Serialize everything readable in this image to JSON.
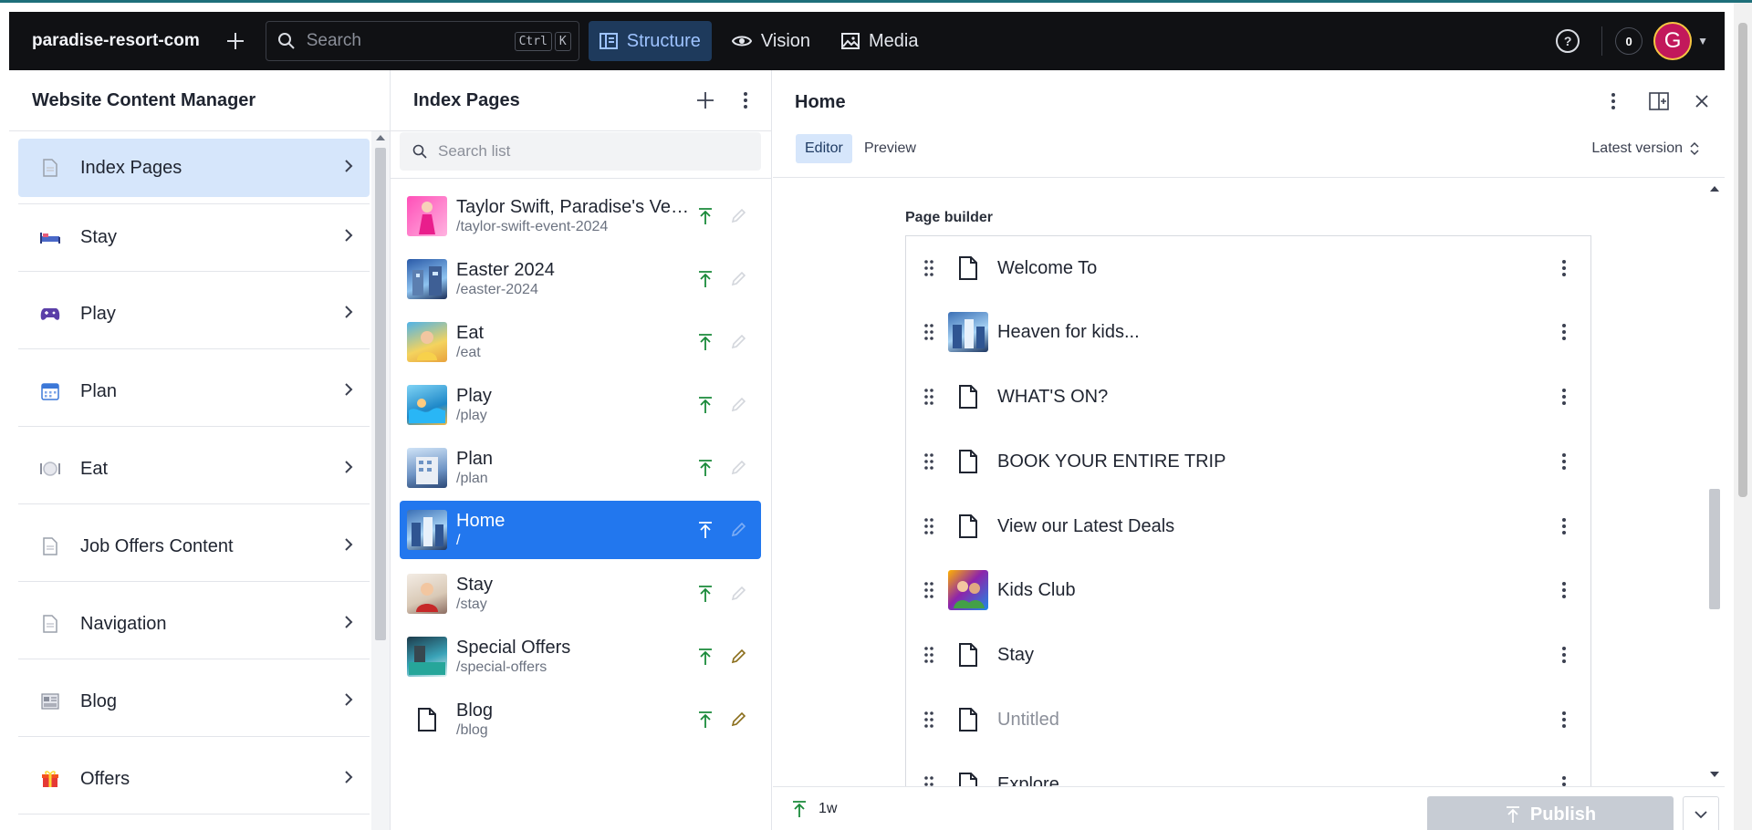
{
  "app": {
    "project_name": "paradise-resort-com",
    "search_placeholder": "Search",
    "search_shortcut": [
      "Ctrl",
      "K"
    ],
    "nav_tabs": [
      {
        "label": "Structure",
        "icon": "structure-icon",
        "active": true
      },
      {
        "label": "Vision",
        "icon": "eye-icon",
        "active": false
      },
      {
        "label": "Media",
        "icon": "image-icon",
        "active": false
      }
    ],
    "notification_count": "0",
    "user_initial": "G"
  },
  "content_manager": {
    "title": "Website Content Manager",
    "items": [
      {
        "label": "Index Pages",
        "icon": "document-icon",
        "active": true
      },
      {
        "label": "Stay",
        "icon": "bed-icon",
        "active": false
      },
      {
        "label": "Play",
        "icon": "gamepad-icon",
        "active": false
      },
      {
        "label": "Plan",
        "icon": "calendar-icon",
        "active": false
      },
      {
        "label": "Eat",
        "icon": "plate-icon",
        "active": false
      },
      {
        "label": "Job Offers Content",
        "icon": "document-icon",
        "active": false
      },
      {
        "label": "Navigation",
        "icon": "document-icon",
        "active": false
      },
      {
        "label": "Blog",
        "icon": "newspaper-icon",
        "active": false
      },
      {
        "label": "Offers",
        "icon": "gift-icon",
        "active": false
      }
    ]
  },
  "index_pages": {
    "title": "Index Pages",
    "search_placeholder": "Search list",
    "documents": [
      {
        "title": "Taylor Swift, Paradise's Vers...",
        "slug": "/taylor-swift-event-2024",
        "thumb": "pink",
        "editable": false,
        "active": false
      },
      {
        "title": "Easter 2024",
        "slug": "/easter-2024",
        "thumb": "blue",
        "editable": false,
        "active": false
      },
      {
        "title": "Eat",
        "slug": "/eat",
        "thumb": "yellow",
        "editable": false,
        "active": false
      },
      {
        "title": "Play",
        "slug": "/play",
        "thumb": "pool",
        "editable": false,
        "active": false
      },
      {
        "title": "Plan",
        "slug": "/plan",
        "thumb": "building",
        "editable": false,
        "active": false
      },
      {
        "title": "Home",
        "slug": "/",
        "thumb": "home",
        "editable": false,
        "active": true
      },
      {
        "title": "Stay",
        "slug": "/stay",
        "thumb": "room",
        "editable": false,
        "active": false
      },
      {
        "title": "Special Offers",
        "slug": "/special-offers",
        "thumb": "teal",
        "editable": true,
        "active": false
      },
      {
        "title": "Blog",
        "slug": "/blog",
        "thumb": "doc",
        "editable": true,
        "active": false
      }
    ]
  },
  "editor": {
    "title": "Home",
    "tabs": [
      {
        "label": "Editor",
        "active": true
      },
      {
        "label": "Preview",
        "active": false
      }
    ],
    "version_label": "Latest version",
    "page_builder_label": "Page builder",
    "blocks": [
      {
        "label": "Welcome To",
        "thumb": "doc",
        "muted": false
      },
      {
        "label": "Heaven for kids...",
        "thumb": "building",
        "muted": false
      },
      {
        "label": "WHAT'S ON?",
        "thumb": "doc",
        "muted": false
      },
      {
        "label": "BOOK YOUR ENTIRE TRIP",
        "thumb": "doc",
        "muted": false
      },
      {
        "label": "View our Latest Deals",
        "thumb": "doc",
        "muted": false
      },
      {
        "label": "Kids Club",
        "thumb": "kids",
        "muted": false
      },
      {
        "label": "Stay",
        "thumb": "doc",
        "muted": false
      },
      {
        "label": "Untitled",
        "thumb": "doc",
        "muted": true
      },
      {
        "label": "Explore",
        "thumb": "doc",
        "muted": false
      }
    ],
    "footer_status": "1w",
    "publish_label": "Publish"
  },
  "colors": {
    "accent": "#2277ee",
    "active_bg": "#d6e6fb",
    "publish_green": "#1a8a3a",
    "edit_gold": "#8a6d1a",
    "navbar_bg": "#101114"
  }
}
